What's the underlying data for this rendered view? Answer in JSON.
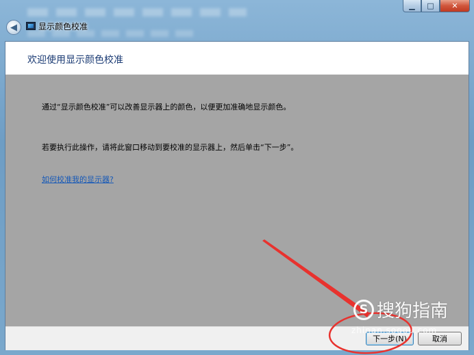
{
  "window": {
    "title": "显示颜色校准",
    "caption": {
      "minimize": "▁",
      "maximize": "□",
      "close": "✕"
    },
    "back_icon": "back-arrow-icon"
  },
  "content": {
    "heading": "欢迎使用显示颜色校准",
    "paragraph1": "通过“显示颜色校准”可以改善显示器上的颜色，以便更加准确地显示颜色。",
    "paragraph2": "若要执行此操作，请将此窗口移动到要校准的显示器上，然后单击“下一步”。",
    "help_link": "如何校准我的显示器?"
  },
  "footer": {
    "next_label": "下一步(N)",
    "cancel_label": "取消"
  },
  "watermark": {
    "logo": "S",
    "text": "搜狗指南",
    "url": "zhinan.sogou.com"
  },
  "colors": {
    "heading": "#1a3a73",
    "link": "#1659b8",
    "annotation": "#e8322e",
    "client_bg": "#a5a5a5"
  }
}
